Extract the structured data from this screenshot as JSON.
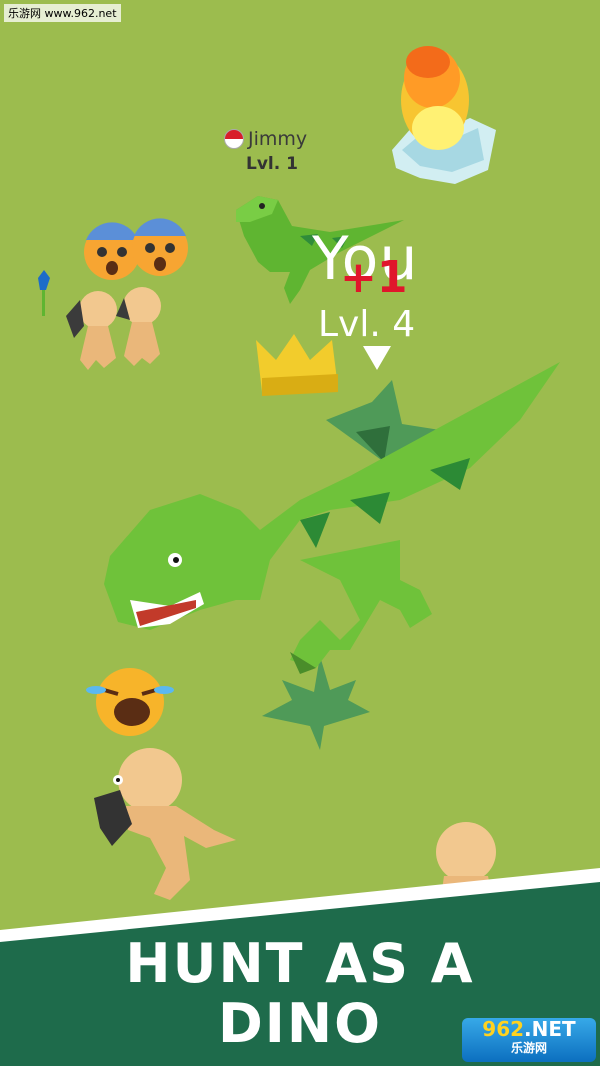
{
  "watermark": "乐游网 www.962.net",
  "player_jimmy": {
    "name": "Jimmy",
    "level": "Lvl. 1"
  },
  "player_you": {
    "name": "You",
    "score_popup": "+1",
    "level": "Lvl. 4"
  },
  "banner": {
    "line1": "HUNT AS A",
    "line2": "DINO"
  },
  "logo": {
    "main_num": "962",
    "main_suffix": ".NET",
    "sub": "乐游网"
  },
  "colors": {
    "grass": "#9cbc4e",
    "dino": "#6fc23a",
    "banner": "#1e6b4b",
    "crown": "#f2cc2c"
  }
}
